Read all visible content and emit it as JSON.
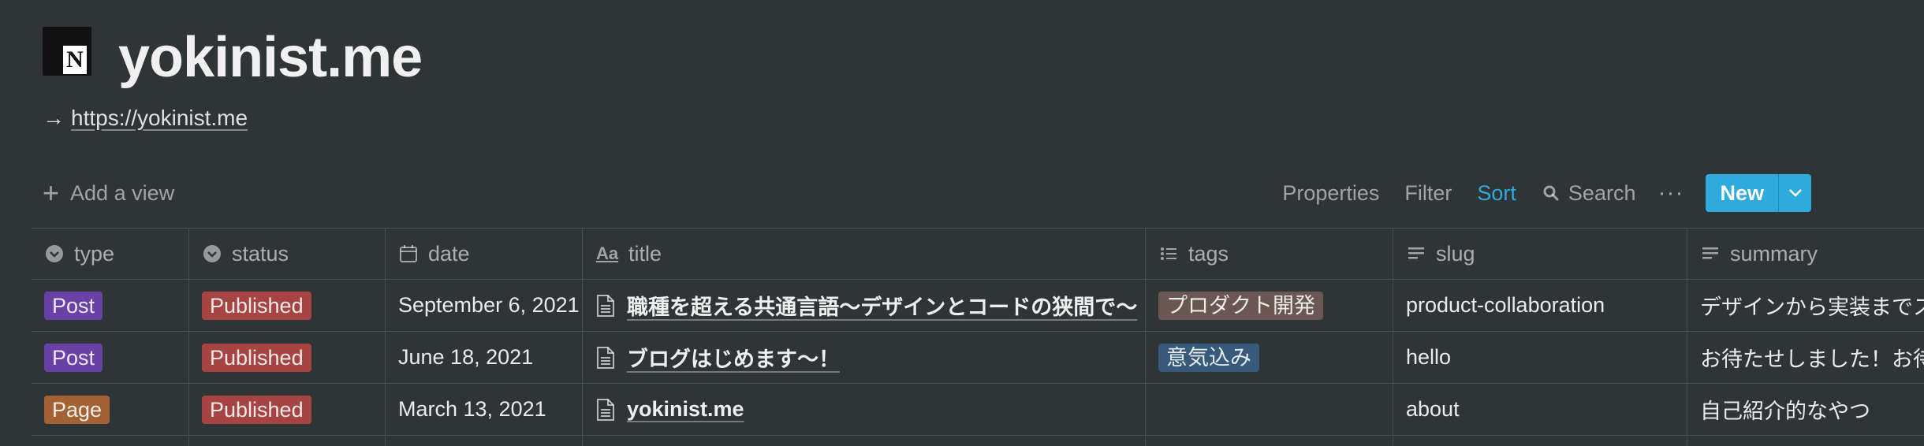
{
  "page": {
    "title": "yokinist.me",
    "link_arrow": "→",
    "link_url": "https://yokinist.me",
    "icon_letter": "N"
  },
  "toolbar": {
    "add_view": "Add a view",
    "properties": "Properties",
    "filter": "Filter",
    "sort": "Sort",
    "search": "Search",
    "more": "···",
    "new": "New"
  },
  "columns": {
    "type": "type",
    "status": "status",
    "date": "date",
    "title": "title",
    "tags": "tags",
    "slug": "slug",
    "summary": "summary"
  },
  "rows": [
    {
      "type": "Post",
      "type_color": "#6940a5",
      "status": "Published",
      "status_color": "#a64443",
      "date": "September 6, 2021",
      "title": "職種を超える共通言語〜デザインとコードの狭間で〜",
      "tag": "プロダクト開発",
      "tag_color": "#6b5751",
      "slug": "product-collaboration",
      "summary": "デザインから実装までス"
    },
    {
      "type": "Post",
      "type_color": "#6940a5",
      "status": "Published",
      "status_color": "#a64443",
      "date": "June 18, 2021",
      "title": "ブログはじめます〜！",
      "tag": "意気込み",
      "tag_color": "#37597a",
      "slug": "hello",
      "summary": "お待たせしました！お待"
    },
    {
      "type": "Page",
      "type_color": "#a26234",
      "status": "Published",
      "status_color": "#a64443",
      "date": "March 13, 2021",
      "title": "yokinist.me",
      "tag": "",
      "tag_color": "",
      "slug": "about",
      "summary": "自己紹介的なやつ"
    }
  ],
  "colors": {
    "background": "#2f3437",
    "accent": "#2eaadc"
  }
}
